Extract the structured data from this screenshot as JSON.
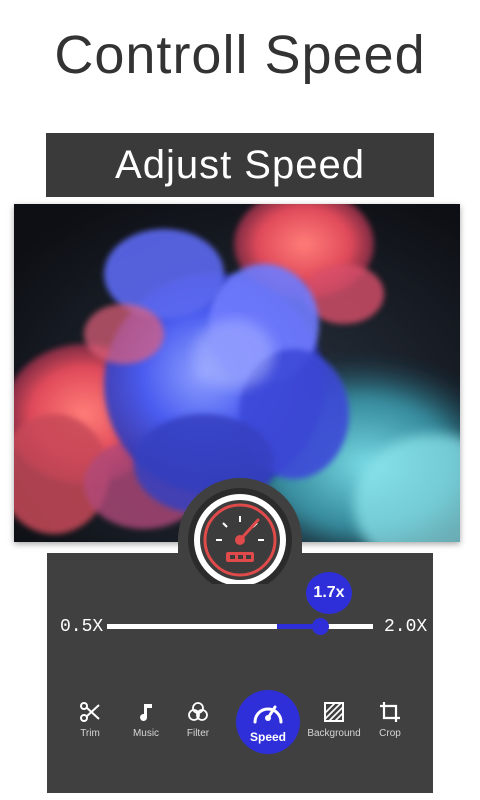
{
  "headline": "Controll Speed",
  "banner": "Adjust Speed",
  "slider": {
    "min_label": "0.5X",
    "max_label": "2.0X",
    "value_label": "1.7x",
    "value": 1.7,
    "min": 0.5,
    "max": 2.0,
    "fill_start": 0.8,
    "accent_color": "#2f2fd9"
  },
  "toolbar": {
    "trim": "Trim",
    "music": "Music",
    "filter": "Filter",
    "speed": "Speed",
    "background": "Background",
    "crop": "Crop"
  }
}
